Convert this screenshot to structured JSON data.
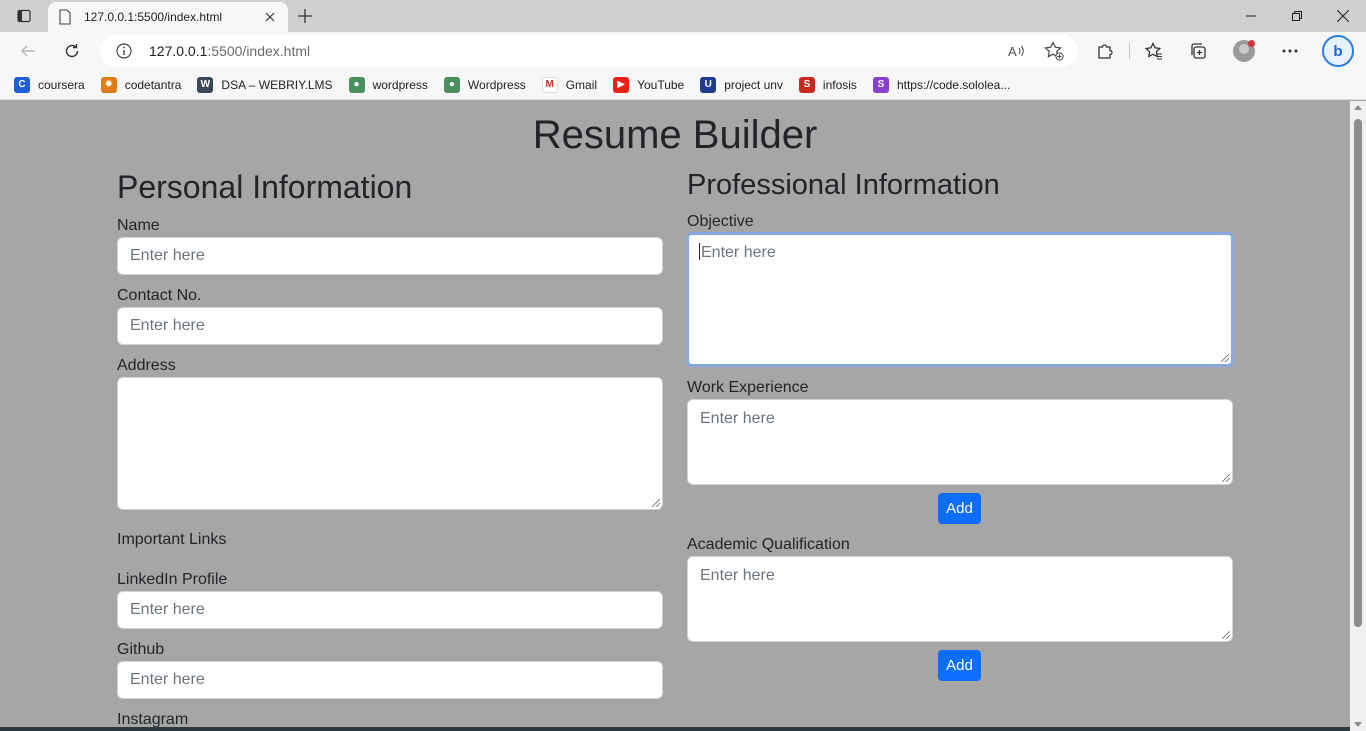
{
  "browser": {
    "tab_title": "127.0.0.1:5500/index.html",
    "url_host": "127.0.0.1",
    "url_rest": ":5500/index.html"
  },
  "bookmarks": [
    {
      "label": "coursera",
      "icon": "coursera-icon",
      "color": "#1f5fd6",
      "glyph": "C"
    },
    {
      "label": "codetantra",
      "icon": "codetantra-icon",
      "color": "#e07b16",
      "glyph": "✹"
    },
    {
      "label": "DSA – WEBRIY.LMS",
      "icon": "wordpress-icon",
      "color": "#3b4a5a",
      "glyph": "W"
    },
    {
      "label": "wordpress",
      "icon": "globe-icon",
      "color": "#4a8f5f",
      "glyph": "●"
    },
    {
      "label": "Wordpress",
      "icon": "globe-icon",
      "color": "#4a8f5f",
      "glyph": "●"
    },
    {
      "label": "Gmail",
      "icon": "gmail-icon",
      "color": "#ffffff",
      "glyph": "M"
    },
    {
      "label": "YouTube",
      "icon": "youtube-icon",
      "color": "#e62117",
      "glyph": "▶"
    },
    {
      "label": "project unv",
      "icon": "university-icon",
      "color": "#1e3c8f",
      "glyph": "U"
    },
    {
      "label": "infosis",
      "icon": "infosis-icon",
      "color": "#c8281e",
      "glyph": "S"
    },
    {
      "label": "https://code.sololea...",
      "icon": "sololearn-icon",
      "color": "#8a3fd1",
      "glyph": "S"
    }
  ],
  "page": {
    "title": "Resume Builder",
    "personal": {
      "heading": "Personal Information",
      "name_label": "Name",
      "name_placeholder": "Enter here",
      "contact_label": "Contact No.",
      "contact_placeholder": "Enter here",
      "address_label": "Address",
      "links_heading": "Important Links",
      "linkedin_label": "LinkedIn Profile",
      "linkedin_placeholder": "Enter here",
      "github_label": "Github",
      "github_placeholder": "Enter here",
      "instagram_label": "Instagram"
    },
    "professional": {
      "heading": "Professional Information",
      "objective_label": "Objective",
      "objective_placeholder": "Enter here",
      "work_label": "Work Experience",
      "work_placeholder": "Enter here",
      "work_add": "Add",
      "academic_label": "Academic Qualification",
      "academic_placeholder": "Enter here",
      "academic_add": "Add"
    }
  },
  "colors": {
    "page_bg": "#a6a6a6",
    "button": "#0d6efd",
    "focus_ring": "#86a8e0"
  }
}
